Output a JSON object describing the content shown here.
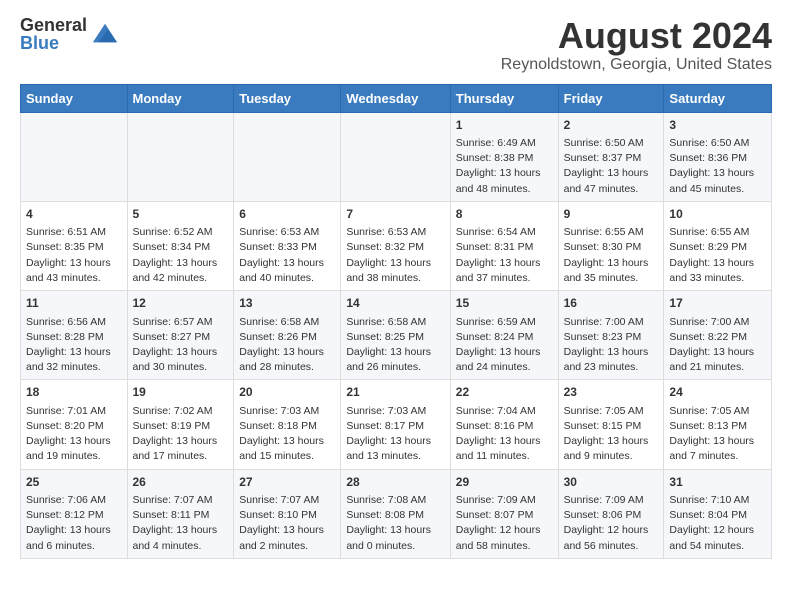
{
  "logo": {
    "general": "General",
    "blue": "Blue"
  },
  "title": "August 2024",
  "subtitle": "Reynoldstown, Georgia, United States",
  "days_of_week": [
    "Sunday",
    "Monday",
    "Tuesday",
    "Wednesday",
    "Thursday",
    "Friday",
    "Saturday"
  ],
  "weeks": [
    [
      {
        "day": "",
        "content": ""
      },
      {
        "day": "",
        "content": ""
      },
      {
        "day": "",
        "content": ""
      },
      {
        "day": "",
        "content": ""
      },
      {
        "day": "1",
        "content": "Sunrise: 6:49 AM\nSunset: 8:38 PM\nDaylight: 13 hours and 48 minutes."
      },
      {
        "day": "2",
        "content": "Sunrise: 6:50 AM\nSunset: 8:37 PM\nDaylight: 13 hours and 47 minutes."
      },
      {
        "day": "3",
        "content": "Sunrise: 6:50 AM\nSunset: 8:36 PM\nDaylight: 13 hours and 45 minutes."
      }
    ],
    [
      {
        "day": "4",
        "content": "Sunrise: 6:51 AM\nSunset: 8:35 PM\nDaylight: 13 hours and 43 minutes."
      },
      {
        "day": "5",
        "content": "Sunrise: 6:52 AM\nSunset: 8:34 PM\nDaylight: 13 hours and 42 minutes."
      },
      {
        "day": "6",
        "content": "Sunrise: 6:53 AM\nSunset: 8:33 PM\nDaylight: 13 hours and 40 minutes."
      },
      {
        "day": "7",
        "content": "Sunrise: 6:53 AM\nSunset: 8:32 PM\nDaylight: 13 hours and 38 minutes."
      },
      {
        "day": "8",
        "content": "Sunrise: 6:54 AM\nSunset: 8:31 PM\nDaylight: 13 hours and 37 minutes."
      },
      {
        "day": "9",
        "content": "Sunrise: 6:55 AM\nSunset: 8:30 PM\nDaylight: 13 hours and 35 minutes."
      },
      {
        "day": "10",
        "content": "Sunrise: 6:55 AM\nSunset: 8:29 PM\nDaylight: 13 hours and 33 minutes."
      }
    ],
    [
      {
        "day": "11",
        "content": "Sunrise: 6:56 AM\nSunset: 8:28 PM\nDaylight: 13 hours and 32 minutes."
      },
      {
        "day": "12",
        "content": "Sunrise: 6:57 AM\nSunset: 8:27 PM\nDaylight: 13 hours and 30 minutes."
      },
      {
        "day": "13",
        "content": "Sunrise: 6:58 AM\nSunset: 8:26 PM\nDaylight: 13 hours and 28 minutes."
      },
      {
        "day": "14",
        "content": "Sunrise: 6:58 AM\nSunset: 8:25 PM\nDaylight: 13 hours and 26 minutes."
      },
      {
        "day": "15",
        "content": "Sunrise: 6:59 AM\nSunset: 8:24 PM\nDaylight: 13 hours and 24 minutes."
      },
      {
        "day": "16",
        "content": "Sunrise: 7:00 AM\nSunset: 8:23 PM\nDaylight: 13 hours and 23 minutes."
      },
      {
        "day": "17",
        "content": "Sunrise: 7:00 AM\nSunset: 8:22 PM\nDaylight: 13 hours and 21 minutes."
      }
    ],
    [
      {
        "day": "18",
        "content": "Sunrise: 7:01 AM\nSunset: 8:20 PM\nDaylight: 13 hours and 19 minutes."
      },
      {
        "day": "19",
        "content": "Sunrise: 7:02 AM\nSunset: 8:19 PM\nDaylight: 13 hours and 17 minutes."
      },
      {
        "day": "20",
        "content": "Sunrise: 7:03 AM\nSunset: 8:18 PM\nDaylight: 13 hours and 15 minutes."
      },
      {
        "day": "21",
        "content": "Sunrise: 7:03 AM\nSunset: 8:17 PM\nDaylight: 13 hours and 13 minutes."
      },
      {
        "day": "22",
        "content": "Sunrise: 7:04 AM\nSunset: 8:16 PM\nDaylight: 13 hours and 11 minutes."
      },
      {
        "day": "23",
        "content": "Sunrise: 7:05 AM\nSunset: 8:15 PM\nDaylight: 13 hours and 9 minutes."
      },
      {
        "day": "24",
        "content": "Sunrise: 7:05 AM\nSunset: 8:13 PM\nDaylight: 13 hours and 7 minutes."
      }
    ],
    [
      {
        "day": "25",
        "content": "Sunrise: 7:06 AM\nSunset: 8:12 PM\nDaylight: 13 hours and 6 minutes."
      },
      {
        "day": "26",
        "content": "Sunrise: 7:07 AM\nSunset: 8:11 PM\nDaylight: 13 hours and 4 minutes."
      },
      {
        "day": "27",
        "content": "Sunrise: 7:07 AM\nSunset: 8:10 PM\nDaylight: 13 hours and 2 minutes."
      },
      {
        "day": "28",
        "content": "Sunrise: 7:08 AM\nSunset: 8:08 PM\nDaylight: 13 hours and 0 minutes."
      },
      {
        "day": "29",
        "content": "Sunrise: 7:09 AM\nSunset: 8:07 PM\nDaylight: 12 hours and 58 minutes."
      },
      {
        "day": "30",
        "content": "Sunrise: 7:09 AM\nSunset: 8:06 PM\nDaylight: 12 hours and 56 minutes."
      },
      {
        "day": "31",
        "content": "Sunrise: 7:10 AM\nSunset: 8:04 PM\nDaylight: 12 hours and 54 minutes."
      }
    ]
  ]
}
